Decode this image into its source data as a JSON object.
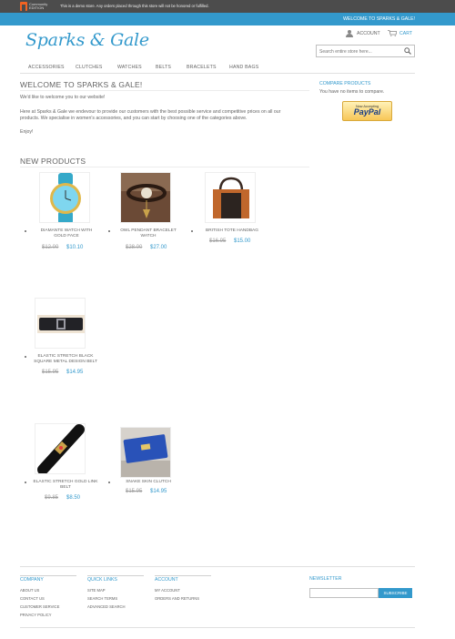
{
  "demo_bar": {
    "logo_line1": "Community",
    "logo_line2": "EDITION",
    "notice": "This is a demo store. Any orders placed through this store will not be honored or fulfilled."
  },
  "welcome_bar": {
    "message": "WELCOME TO SPARKS & GALE!"
  },
  "header": {
    "logo_text": "Sparks & Gale",
    "account_label": "ACCOUNT",
    "cart_label": "CART",
    "search_placeholder": "Search entire store here..."
  },
  "nav": [
    "ACCESSORIES",
    "CLUTCHES",
    "WATCHES",
    "BELTS",
    "BRACELETS",
    "HAND BAGS"
  ],
  "main": {
    "welcome_heading": "WELCOME TO SPARKS & GALE!",
    "intro": "We'd like to welcome you to our website!",
    "body_line1": "Here at Sparks & Gale we endevour to provide our customers with the best possible service and competitive prices on all our",
    "body_line2": "products.  We specialise in women's accessories, and you can start by choosing one of the categories above.",
    "closing": "Enjoy!",
    "new_products_heading": "NEW PRODUCTS"
  },
  "sidebar": {
    "compare_title": "COMPARE PRODUCTS",
    "compare_text": "You have no items to compare.",
    "paypal_small": "Now Accepting",
    "paypal_big": "PayPal"
  },
  "products": [
    {
      "name_line1": "DIAMANTE WATCH WITH",
      "name_line2": "GOLD FACE",
      "old_price": "$12.00",
      "price": "$10.10"
    },
    {
      "name_line1": "OWL PENDANT BRACELET",
      "name_line2": "WATCH",
      "old_price": "$28.00",
      "price": "$27.00"
    },
    {
      "name_line1": "BRITISH TOTE HANDBAG",
      "name_line2": "",
      "old_price": "$16.95",
      "price": "$15.00"
    },
    {
      "name_line1": "ELASTIC STRETCH BLACK",
      "name_line2": "SQUARE METAL DESIGN BELT",
      "old_price": "$15.95",
      "price": "$14.95"
    },
    {
      "name_line1": "ELASTIC STRETCH GOLD LINK",
      "name_line2": "BELT",
      "old_price": "$9.85",
      "price": "$8.50"
    },
    {
      "name_line1": "SNAKE SKIN CLUTCH",
      "name_line2": "",
      "old_price": "$15.95",
      "price": "$14.95"
    }
  ],
  "footer": {
    "company_title": "COMPANY",
    "company_links": [
      "ABOUT US",
      "CONTACT US",
      "CUSTOMER SERVICE",
      "PRIVACY POLICY"
    ],
    "quick_title": "QUICK LINKS",
    "quick_links": [
      "SITE MAP",
      "SEARCH TERMS",
      "ADVANCED SEARCH"
    ],
    "account_title": "ACCOUNT",
    "account_links": [
      "MY ACCOUNT",
      "ORDERS AND RETURNS"
    ],
    "newsletter_title": "NEWSLETTER",
    "subscribe_label": "SUBSCRIBE"
  },
  "colors": {
    "accent": "#3399cc",
    "demo_bar": "#4c4c4c",
    "text": "#636363"
  }
}
